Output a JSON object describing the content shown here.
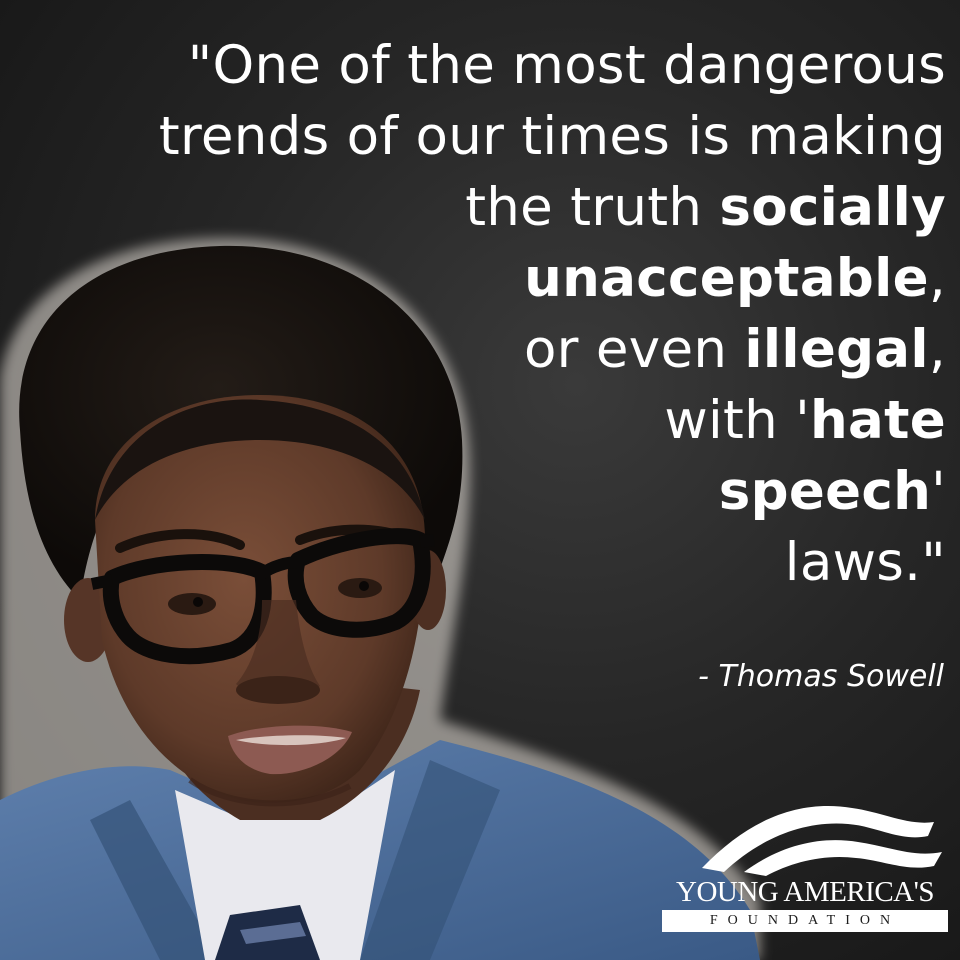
{
  "quote": {
    "lines": [
      [
        {
          "t": "\"One of the most dangerous",
          "b": false
        }
      ],
      [
        {
          "t": "trends of our times is making",
          "b": false
        }
      ],
      [
        {
          "t": "the truth ",
          "b": false
        },
        {
          "t": "socially",
          "b": true
        }
      ],
      [
        {
          "t": "unacceptable",
          "b": true
        },
        {
          "t": ",",
          "b": false
        }
      ],
      [
        {
          "t": "or even ",
          "b": false
        },
        {
          "t": "illegal",
          "b": true
        },
        {
          "t": ",",
          "b": false
        }
      ],
      [
        {
          "t": "with '",
          "b": false
        },
        {
          "t": "hate",
          "b": true
        }
      ],
      [
        {
          "t": "speech",
          "b": true
        },
        {
          "t": "'",
          "b": false
        }
      ],
      [
        {
          "t": "laws.\"",
          "b": false
        }
      ]
    ]
  },
  "attribution": "- Thomas Sowell",
  "logo": {
    "name": "YOUNG AMERICA'S",
    "subtitle": "FOUNDATION"
  },
  "colors": {
    "background": "#232323",
    "text": "#ffffff",
    "suit": "#4a6a96"
  },
  "icons": {
    "logo_mark": "waving-flag-icon"
  }
}
